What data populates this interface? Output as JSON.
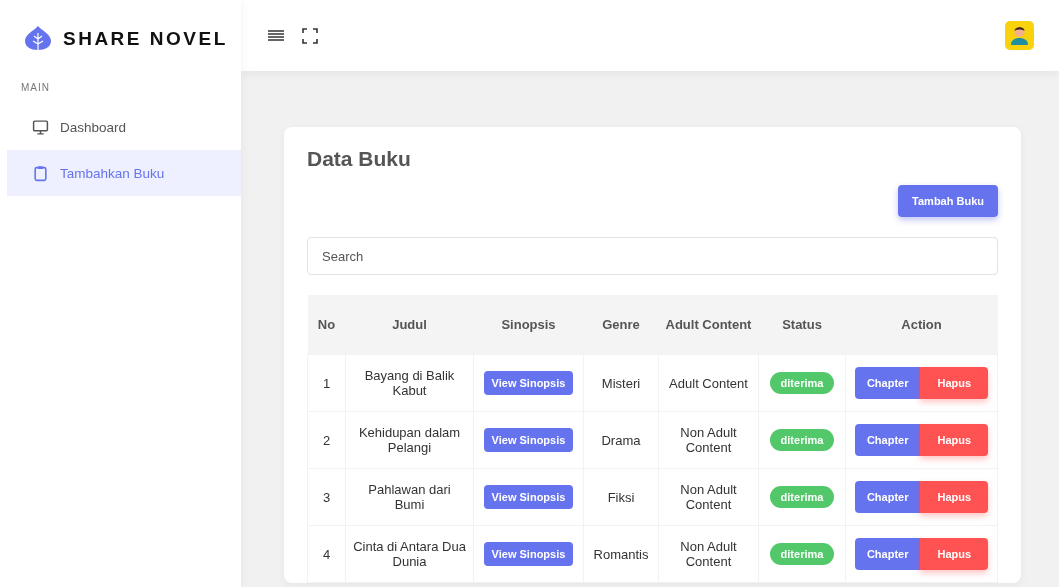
{
  "brand": {
    "name": "SHARE NOVEL"
  },
  "sidebar": {
    "section": "MAIN",
    "items": [
      {
        "label": "Dashboard",
        "kind": "monitor",
        "selected": false
      },
      {
        "label": "Tambahkan Buku",
        "kind": "clipboard",
        "selected": true
      }
    ]
  },
  "card": {
    "title": "Data Buku",
    "add_button": "Tambah Buku",
    "search": {
      "placeholder": "Search"
    }
  },
  "table": {
    "columns": [
      "No",
      "Judul",
      "Sinopsis",
      "Genre",
      "Adult Content",
      "Status",
      "Action"
    ],
    "rows": [
      {
        "no": "1",
        "judul": "Bayang di Balik Kabut",
        "sinopsis": "View Sinopsis",
        "genre": "Misteri",
        "adult": "Adult Content",
        "status": "diterima",
        "actions": [
          "Chapter",
          "Hapus"
        ]
      },
      {
        "no": "2",
        "judul": "Kehidupan dalam Pelangi",
        "sinopsis": "View Sinopsis",
        "genre": "Drama",
        "adult": "Non Adult Content",
        "status": "diterima",
        "actions": [
          "Chapter",
          "Hapus"
        ]
      },
      {
        "no": "3",
        "judul": "Pahlawan dari Bumi",
        "sinopsis": "View Sinopsis",
        "genre": "Fiksi",
        "adult": "Non Adult Content",
        "status": "diterima",
        "actions": [
          "Chapter",
          "Hapus"
        ]
      },
      {
        "no": "4",
        "judul": "Cinta di Antara Dua Dunia",
        "sinopsis": "View Sinopsis",
        "genre": "Romantis",
        "adult": "Non Adult Content",
        "status": "diterima",
        "actions": [
          "Chapter",
          "Hapus"
        ]
      }
    ]
  }
}
